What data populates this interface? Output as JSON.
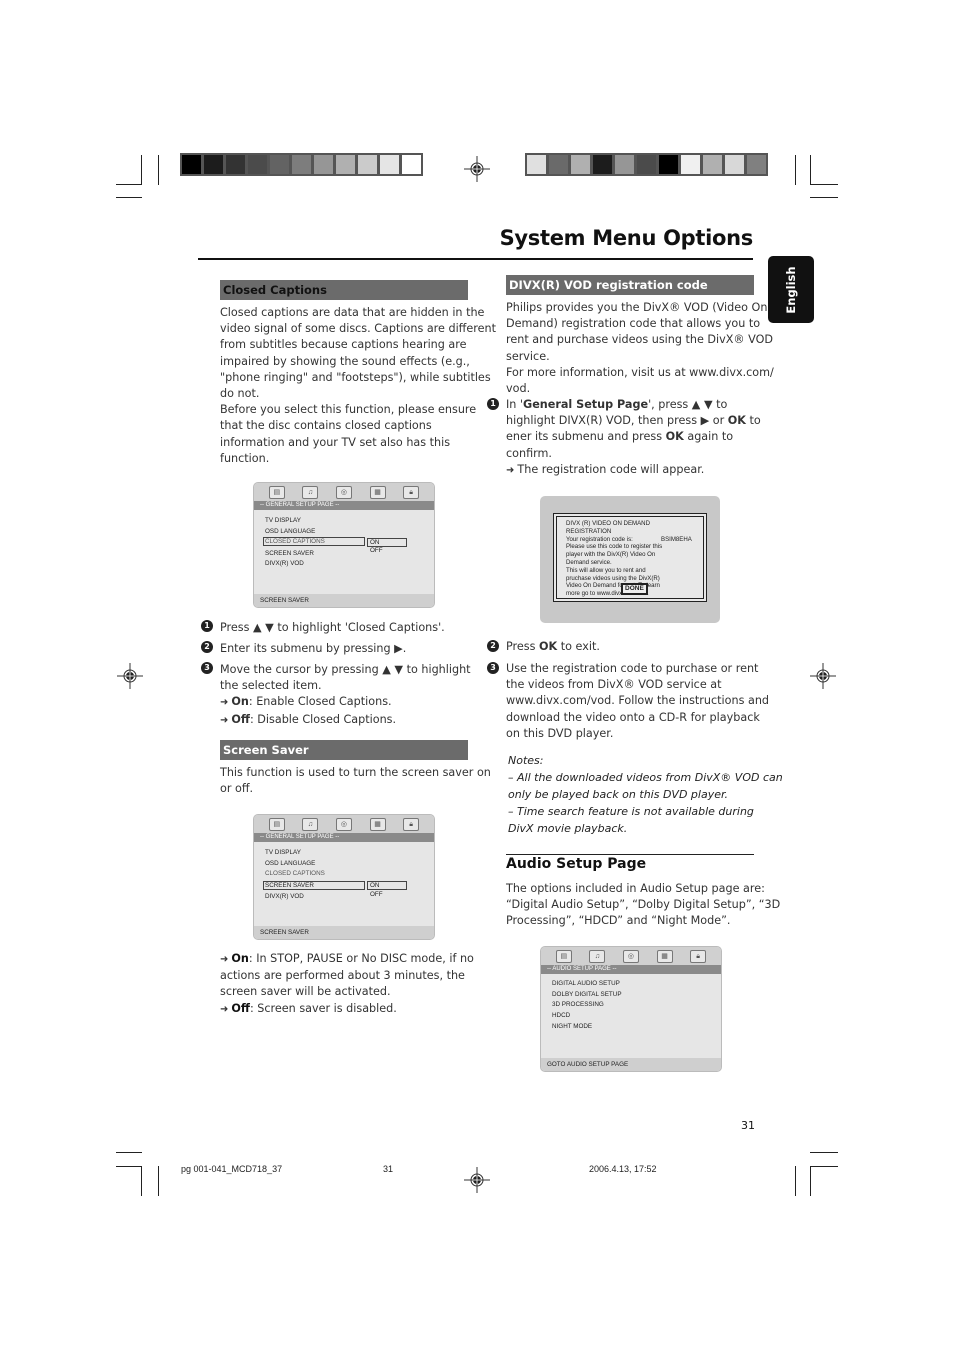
{
  "header": {
    "title": "System Menu Options",
    "language_tab": "English",
    "colorbar_left": [
      "#000000",
      "#1c1c1c",
      "#333333",
      "#4b4b4b",
      "#636363",
      "#7d7d7d",
      "#969696",
      "#b0b0b0",
      "#cbcbcb",
      "#e5e5e5",
      "#ffffff"
    ],
    "colorbar_right": [
      "#e0e0e0",
      "#6a6a6a",
      "#b0b0b0",
      "#1c1c1c",
      "#969696",
      "#4b4b4b",
      "#000000",
      "#f0f0f0",
      "#b0b0b0",
      "#d8d8d8",
      "#808080"
    ]
  },
  "closed_captions": {
    "heading": "Closed Captions",
    "body_lines": [
      "Closed captions are data that are hidden in the",
      "video signal of some discs. Captions are different",
      "from subtitles because captions hearing are",
      "impaired by showing the sound effects (e.g.,",
      "\"phone ringing\" and \"footsteps\"), while subtitles",
      "do not.",
      "Before you select this function, please ensure",
      "that the disc contains closed captions",
      "information and your TV set also has this",
      "function."
    ],
    "screen": {
      "banner": "-- GENERAL SETUP PAGE --",
      "items": [
        "TV DISPLAY",
        "OSD LANGUAGE",
        "CLOSED CAPTIONS",
        "SCREEN SAVER",
        "DIVX(R) VOD"
      ],
      "selected": "CLOSED CAPTIONS",
      "submenu": [
        "ON",
        "OFF"
      ],
      "footer": "SCREEN SAVER"
    },
    "steps": [
      {
        "num": "1",
        "text": "Press ▲ ▼  to highlight 'Closed Captions'."
      },
      {
        "num": "2",
        "text": "Enter its submenu by pressing ▶."
      },
      {
        "num": "3",
        "line1": "Move the cursor by pressing ▲ ▼  to highlight",
        "line2": "the selected item."
      }
    ],
    "options": [
      {
        "label": "On",
        "desc": ": Enable Closed Captions."
      },
      {
        "label": "Off",
        "desc": ": Disable Closed Captions."
      }
    ]
  },
  "screen_saver": {
    "heading": "Screen Saver",
    "body_lines": [
      "This function is used to turn the screen saver on",
      "or off."
    ],
    "screen": {
      "banner": "-- GENERAL SETUP PAGE --",
      "items": [
        "TV DISPLAY",
        "OSD LANGUAGE",
        "CLOSED CAPTIONS",
        "SCREEN SAVER",
        "DIVX(R) VOD"
      ],
      "selected": "SCREEN SAVER",
      "submenu": [
        "ON",
        "OFF"
      ],
      "footer": "SCREEN SAVER"
    },
    "on_label": "On",
    "on_lines": [
      ": In STOP, PAUSE or No DISC mode, if no",
      "actions are performed about 3 minutes, the",
      "screen saver will be activated."
    ],
    "off_label": "Off",
    "off_desc": ": Screen saver is disabled."
  },
  "divx": {
    "heading": "DIVX(R) VOD registration code",
    "body_lines": [
      "Philips provides you the DivX® VOD (Video On",
      "Demand) registration code that allows you to",
      "rent and purchase videos using the DivX® VOD",
      "service.",
      "For more information, visit us at www.divx.com/",
      "vod."
    ],
    "step1": {
      "num": "1",
      "pre": "In '",
      "bold1": "General Setup Page",
      "mid": "', press ▲ ▼ to",
      "line2_pre": "highlight DIVX(R) VOD, then press ▶ or ",
      "bold2": "OK",
      "line2_post": " to",
      "line3_pre": "ener its submenu and press ",
      "bold3": "OK",
      "line3_post": " again to",
      "line4": "confirm.",
      "result": "The registration code will appear."
    },
    "dialog": {
      "title": "DIVX (R) VIDEO ON DEMAND REGISTRATION",
      "code_label": "Your registration code is:",
      "code": "BSIM8EHA",
      "lines": [
        "Please use this code to register this",
        "player with the DivX(R) Video On",
        "Demand service.",
        "This will allow you to rent and",
        "pruchase videos using the DivX(R)",
        "Video On Demand format. To learn",
        "more go to www.divx.com/vod."
      ],
      "done_button": "DONE"
    },
    "step2": {
      "num": "2",
      "pre": "Press ",
      "bold": "OK",
      "post": " to exit."
    },
    "step3": {
      "num": "3",
      "lines": [
        "Use the registration code to purchase or rent",
        "the videos from DivX® VOD service at",
        "www.divx.com/vod. Follow the instructions and",
        "download the video onto a CD-R for playback",
        "on this DVD player."
      ]
    },
    "notes_title": "Notes:",
    "notes": [
      "–   All the downloaded videos from DivX® VOD can",
      "only be played back on this DVD player.",
      "–   Time search feature is not available during",
      "DivX movie playback."
    ]
  },
  "audio_setup": {
    "heading": "Audio Setup Page",
    "body_lines": [
      "The options included in Audio Setup page are:",
      "“Digital Audio Setup”, “Dolby Digital Setup”, “3D",
      "Processing”, “HDCD” and “Night Mode”."
    ],
    "screen": {
      "banner": "-- AUDIO SETUP PAGE --",
      "items": [
        "DIGITAL AUDIO SETUP",
        "DOLBY DIGITAL SETUP",
        "3D PROCESSING",
        "HDCD",
        "NIGHT MODE"
      ],
      "footer": "GOTO AUDIO SETUP PAGE"
    }
  },
  "footer": {
    "page_number": "31",
    "file": "pg 001-041_MCD718_37",
    "sheet": "31",
    "timestamp": "2006.4.13, 17:52"
  }
}
